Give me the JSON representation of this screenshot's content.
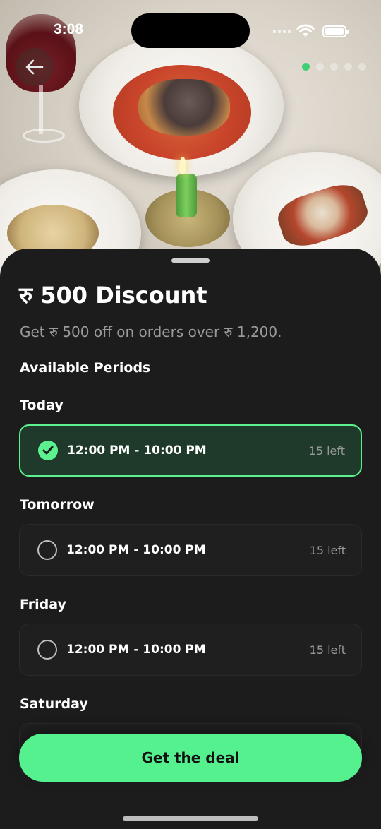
{
  "status_bar": {
    "time": "3:08"
  },
  "hero": {
    "image": "restaurant-food-photo",
    "page_dots": 5,
    "active_dot": 0
  },
  "deal": {
    "title": "रु 500 Discount",
    "description": "Get रु 500 off on orders over रु 1,200."
  },
  "periods": {
    "heading": "Available Periods",
    "days": [
      {
        "label": "Today",
        "time": "12:00 PM - 10:00 PM",
        "left": "15 left",
        "selected": true
      },
      {
        "label": "Tomorrow",
        "time": "12:00 PM - 10:00 PM",
        "left": "15 left",
        "selected": false
      },
      {
        "label": "Friday",
        "time": "12:00 PM - 10:00 PM",
        "left": "15 left",
        "selected": false
      },
      {
        "label": "Saturday"
      }
    ]
  },
  "cta": {
    "label": "Get the deal"
  },
  "colors": {
    "accent": "#56f18f",
    "sheet": "#1c1c1c",
    "muted_text": "#9a9a9a"
  }
}
